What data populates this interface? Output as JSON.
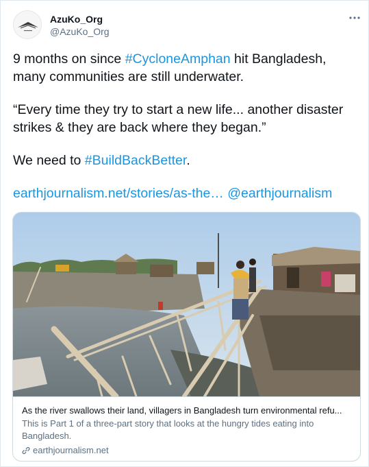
{
  "author": {
    "display_name": "AzuKo_Org",
    "handle": "@AzuKo_Org",
    "avatar_icon": "azuko-logo-icon"
  },
  "menu": {
    "icon": "more-horizontal-icon"
  },
  "tweet": {
    "line1_prefix": "9 months on since ",
    "hashtag1": "#CycloneAmphan",
    "line1_suffix": " hit Bangladesh,",
    "line2": "many communities are still underwater.",
    "quote_line1": "“Every time they try to start a new life... another disaster",
    "quote_line2": "strikes & they are back where they began.”",
    "cta_prefix": "We need to ",
    "hashtag2": "#BuildBackBetter",
    "cta_suffix": ".",
    "url": "earthjournalism.net/stories/as-the…",
    "mention": "@earthjournalism"
  },
  "card": {
    "title": "As the river swallows their land, villagers in Bangladesh turn environmental refu...",
    "description": "This is Part 1 of a three-part story that looks at the hungry tides eating into Bangladesh.",
    "domain": "earthjournalism.net",
    "link_icon": "link-icon"
  },
  "colors": {
    "link": "#1b95e0",
    "text": "#0f1419",
    "secondary": "#5b7083",
    "border": "#cfd9de"
  }
}
